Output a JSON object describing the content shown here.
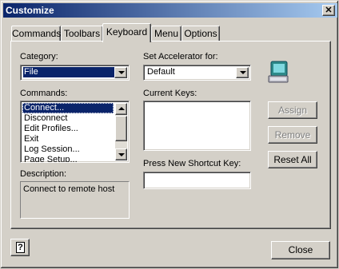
{
  "window": {
    "title": "Customize",
    "close_glyph": "✕"
  },
  "tabs": [
    {
      "label": "Commands"
    },
    {
      "label": "Toolbars"
    },
    {
      "label": "Keyboard"
    },
    {
      "label": "Menu"
    },
    {
      "label": "Options"
    }
  ],
  "active_tab": "Keyboard",
  "category": {
    "label": "Category:",
    "value": "File"
  },
  "commands": {
    "label": "Commands:",
    "items": [
      "Connect...",
      "Disconnect",
      "Edit Profiles...",
      "Exit",
      "Log Session...",
      "Page Setup..."
    ],
    "selected": "Connect..."
  },
  "description": {
    "label": "Description:",
    "text": "Connect to remote host"
  },
  "accelerator": {
    "label": "Set Accelerator for:",
    "value": "Default"
  },
  "current_keys": {
    "label": "Current Keys:"
  },
  "shortcut": {
    "label": "Press New Shortcut Key:",
    "value": ""
  },
  "buttons": {
    "assign": "Assign",
    "remove": "Remove",
    "reset_all": "Reset All",
    "close": "Close"
  },
  "help": {
    "glyph": "?"
  },
  "icon": "keyboard-monitor-icon",
  "colors": {
    "titlebar": "#0a246a",
    "selection": "#0a246a",
    "face": "#d4d0c8"
  }
}
